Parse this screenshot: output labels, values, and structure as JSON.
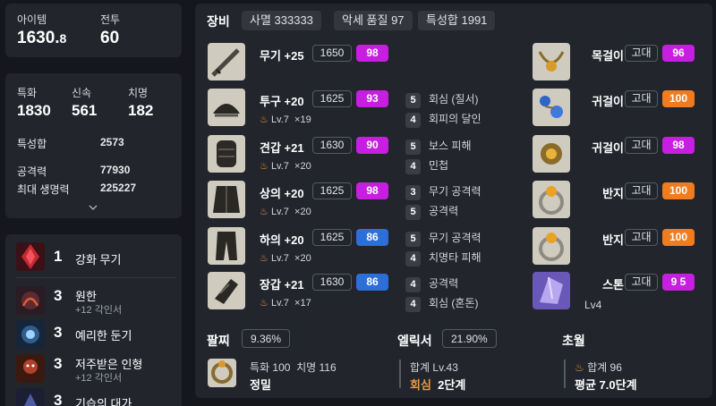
{
  "stats": {
    "item_label": "아이템",
    "item_value": "1630.",
    "item_decimal": "8",
    "battle_label": "전투",
    "battle_value": "60",
    "crit_label": "특화",
    "crit_value": "1830",
    "swift_label": "신속",
    "swift_value": "561",
    "critical_label": "치명",
    "critical_value": "182",
    "total_label": "특성합",
    "total_value": "2573",
    "atk_label": "공격력",
    "atk_value": "77930",
    "hp_label": "최대 생명력",
    "hp_value": "225227"
  },
  "engravings": [
    {
      "level": "1",
      "name": "강화 무기",
      "sub": ""
    },
    {
      "level": "3",
      "name": "원한",
      "sub": "+12 각인서"
    },
    {
      "level": "3",
      "name": "예리한 둔기",
      "sub": ""
    },
    {
      "level": "3",
      "name": "저주받은 인형",
      "sub": "+12 각인서"
    },
    {
      "level": "3",
      "name": "기습의 대가",
      "sub": ""
    }
  ],
  "equipment_header": {
    "title": "장비",
    "tag1": "사멸 333333",
    "tag2": "악세 품질 97",
    "tag3": "특성합 1991"
  },
  "gear": [
    {
      "name": "무기 +25",
      "ilvl": "1650",
      "quality": "98",
      "lv": "",
      "count": ""
    },
    {
      "name": "투구 +20",
      "ilvl": "1625",
      "quality": "93",
      "lv": "Lv.7",
      "count": "×19"
    },
    {
      "name": "견갑 +21",
      "ilvl": "1630",
      "quality": "90",
      "lv": "Lv.7",
      "count": "×20"
    },
    {
      "name": "상의 +20",
      "ilvl": "1625",
      "quality": "98",
      "lv": "Lv.7",
      "count": "×20"
    },
    {
      "name": "하의 +20",
      "ilvl": "1625",
      "quality": "86",
      "lv": "Lv.7",
      "count": "×20"
    },
    {
      "name": "장갑 +21",
      "ilvl": "1630",
      "quality": "86",
      "lv": "Lv.7",
      "count": "×17"
    }
  ],
  "gear_engr": [
    {
      "n": "5",
      "t": "회심 (질서)"
    },
    {
      "n": "4",
      "t": "회피의 달인"
    },
    {
      "n": "5",
      "t": "보스 피해"
    },
    {
      "n": "4",
      "t": "민첩"
    },
    {
      "n": "3",
      "t": "무기 공격력"
    },
    {
      "n": "5",
      "t": "공격력"
    },
    {
      "n": "5",
      "t": "무기 공격력"
    },
    {
      "n": "4",
      "t": "치명타 피해"
    },
    {
      "n": "4",
      "t": "공격력"
    },
    {
      "n": "4",
      "t": "회심 (혼돈)"
    }
  ],
  "accessories": [
    {
      "name": "목걸이",
      "grade": "고대",
      "quality": "96"
    },
    {
      "name": "귀걸이",
      "grade": "고대",
      "quality": "100"
    },
    {
      "name": "귀걸이",
      "grade": "고대",
      "quality": "98"
    },
    {
      "name": "반지",
      "grade": "고대",
      "quality": "100"
    },
    {
      "name": "반지",
      "grade": "고대",
      "quality": "100"
    },
    {
      "name": "스톤",
      "grade": "고대",
      "quality": "9 5",
      "extra": "Lv4"
    }
  ],
  "bracelet": {
    "title": "팔찌",
    "pct": "9.36%",
    "line1": "특화 100  치명 116",
    "line2": "정밀"
  },
  "elixir": {
    "title": "엘릭서",
    "pct": "21.90%",
    "line1": "합계 Lv.43",
    "line2a": "회심",
    "line2b": "2단계"
  },
  "transcend": {
    "title": "초월",
    "line1": "합계 96",
    "line2": "평균 7.0단계"
  },
  "colors": {
    "magenta": "#c71fdf",
    "blue": "#2c6fd9",
    "orange": "#f07c1f"
  }
}
